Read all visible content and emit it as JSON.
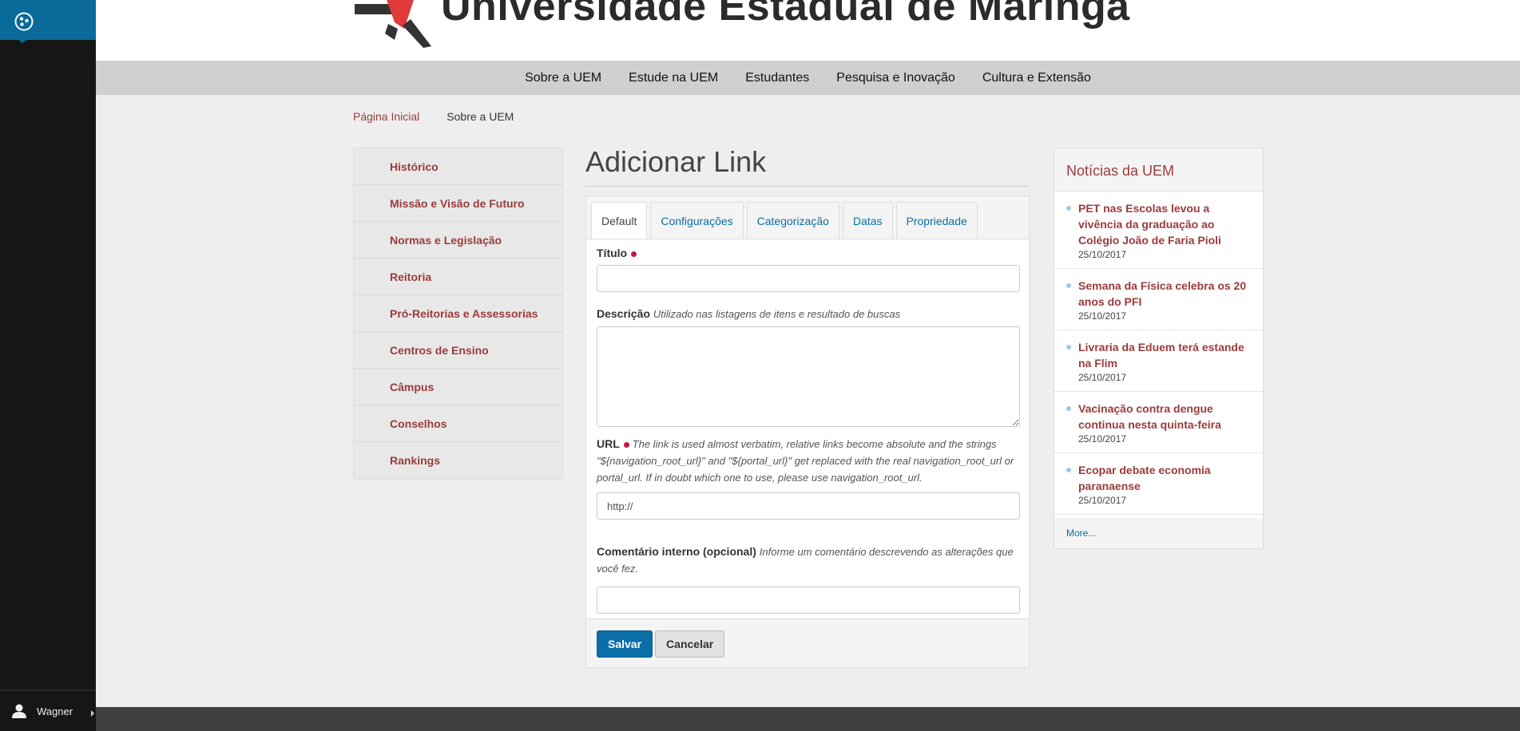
{
  "toolbar": {
    "user_name": "Wagner"
  },
  "header": {
    "site_name": "Universidade Estadual de Maringá"
  },
  "nav": {
    "items": [
      "Sobre a UEM",
      "Estude na UEM",
      "Estudantes",
      "Pesquisa e Inovação",
      "Cultura e Extensão"
    ]
  },
  "breadcrumb": {
    "home": "Página Inicial",
    "current": "Sobre a UEM"
  },
  "sidenav": {
    "items": [
      "Histórico",
      "Missão e Visão de Futuro",
      "Normas e Legislação",
      "Reitoria",
      "Pró-Reitorias e Assessorias",
      "Centros de Ensino",
      "Câmpus",
      "Conselhos",
      "Rankings"
    ]
  },
  "main": {
    "title": "Adicionar Link",
    "tabs": [
      "Default",
      "Configurações",
      "Categorização",
      "Datas",
      "Propriedade"
    ],
    "fields": {
      "titulo": {
        "label": "Título",
        "value": ""
      },
      "descricao": {
        "label": "Descrição",
        "help": "Utilizado nas listagens de itens e resultado de buscas",
        "value": ""
      },
      "url": {
        "label": "URL",
        "help": "The link is used almost verbatim, relative links become absolute and the strings \"${navigation_root_url}\" and \"${portal_url}\" get replaced with the real navigation_root_url or portal_url. If in doubt which one to use, please use navigation_root_url.",
        "value": "http://"
      },
      "comentario": {
        "label": "Comentário interno (opcional)",
        "help": "Informe um comentário descrevendo as alterações que você fez.",
        "value": ""
      }
    },
    "buttons": {
      "save": "Salvar",
      "cancel": "Cancelar"
    }
  },
  "news": {
    "title": "Notícias da UEM",
    "items": [
      {
        "title": "PET nas Escolas levou a vivência da graduação ao Colégio João de Faria Pioli",
        "date": "25/10/2017"
      },
      {
        "title": "Semana da Física celebra os 20 anos do PFI",
        "date": "25/10/2017"
      },
      {
        "title": "Livraria da Eduem terá estande na Flim",
        "date": "25/10/2017"
      },
      {
        "title": "Vacinação contra dengue continua nesta quinta-feira",
        "date": "25/10/2017"
      },
      {
        "title": "Ecopar debate economia paranaense",
        "date": "25/10/2017"
      }
    ],
    "more": "More..."
  },
  "colors": {
    "accent_blue": "#0a6ea8",
    "link_red": "#9b3b3b",
    "required_dot": "#c4183c"
  }
}
